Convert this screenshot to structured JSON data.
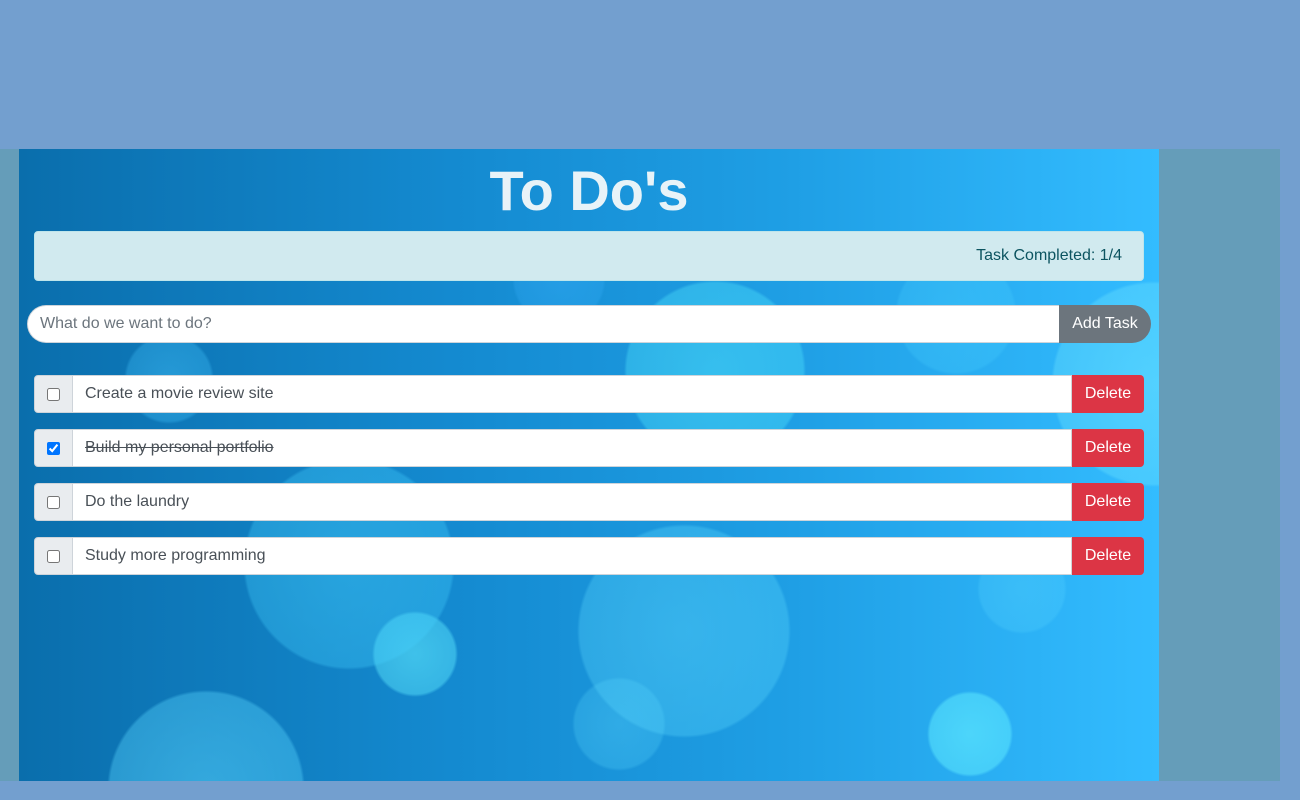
{
  "colors": {
    "page_background": "#739fcf",
    "outer_panel": "#659db9",
    "counter_background": "#d1eaef",
    "counter_text": "#0c5460",
    "add_button": "#6c757d",
    "delete_button": "#dc3545"
  },
  "header": {
    "title": "To Do's"
  },
  "counter": {
    "text": "Task Completed: 1/4"
  },
  "add_task": {
    "placeholder": "What do we want to do?",
    "value": "",
    "button_label": "Add Task"
  },
  "tasks": [
    {
      "text": "Create a movie review site",
      "completed": false,
      "delete_label": "Delete"
    },
    {
      "text": "Build my personal portfolio",
      "completed": true,
      "delete_label": "Delete"
    },
    {
      "text": "Do the laundry",
      "completed": false,
      "delete_label": "Delete"
    },
    {
      "text": "Study more programming",
      "completed": false,
      "delete_label": "Delete"
    }
  ]
}
